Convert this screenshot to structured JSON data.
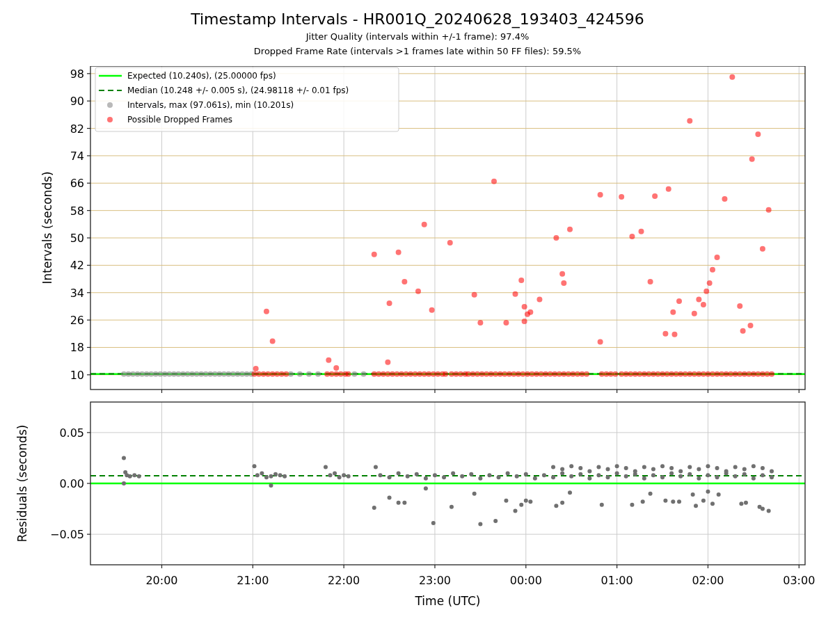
{
  "title": "Timestamp Intervals - HR001Q_20240628_193403_424596",
  "subtitles": [
    "Jitter Quality (intervals within +/-1 frame): 97.4%",
    "Dropped Frame Rate (intervals >1 frames late within 50 FF files): 59.5%"
  ],
  "plots": [
    {
      "chart_data": {
        "type": "scatter",
        "ylabel": "Intervals (seconds)",
        "xlim": [
          "2024-06-28T19:13",
          "2024-06-29T03:04"
        ],
        "ylim": [
          5.7,
          100.2
        ],
        "yticks": [
          10,
          18,
          26,
          34,
          42,
          50,
          58,
          66,
          74,
          82,
          90,
          98
        ],
        "grid": true,
        "legend": "upper left",
        "ref_lines": [
          {
            "axis": "y",
            "value": 10.24,
            "label": "Expected (10.240s), (25.00000 fps)",
            "color": "#00ff00"
          },
          {
            "axis": "y",
            "value": 10.248,
            "label": "Median (10.248 +/- 0.005 s), (24.98118 +/- 0.01 fps)",
            "color": "#008000"
          }
        ],
        "series": [
          {
            "name": "Intervals, max (97.061s), min (10.201s)",
            "color": "#808080",
            "x": [
              "2024-06-28T19:35",
              "2024-06-28T19:38",
              "2024-06-28T19:41",
              "2024-06-28T19:44",
              "2024-06-28T19:47",
              "2024-06-28T19:50",
              "2024-06-28T19:53",
              "2024-06-28T19:56",
              "2024-06-28T19:59",
              "2024-06-28T20:02",
              "2024-06-28T20:05",
              "2024-06-28T20:08",
              "2024-06-28T20:11",
              "2024-06-28T20:14",
              "2024-06-28T20:17",
              "2024-06-28T20:20",
              "2024-06-28T20:23",
              "2024-06-28T20:26",
              "2024-06-28T20:29",
              "2024-06-28T20:32",
              "2024-06-28T20:35",
              "2024-06-28T20:38",
              "2024-06-28T20:41",
              "2024-06-28T20:44",
              "2024-06-28T20:47",
              "2024-06-28T20:50",
              "2024-06-28T20:53",
              "2024-06-28T20:56",
              "2024-06-28T20:59",
              "2024-06-28T21:25",
              "2024-06-28T21:31",
              "2024-06-28T21:37",
              "2024-06-28T21:43",
              "2024-06-28T22:07",
              "2024-06-28T22:13"
            ],
            "values": [
              10.24,
              10.24,
              10.24,
              10.24,
              10.24,
              10.24,
              10.24,
              10.24,
              10.24,
              10.24,
              10.24,
              10.24,
              10.24,
              10.24,
              10.24,
              10.24,
              10.24,
              10.24,
              10.24,
              10.24,
              10.24,
              10.24,
              10.24,
              10.24,
              10.24,
              10.24,
              10.24,
              10.24,
              10.24,
              10.24,
              10.24,
              10.24,
              10.24,
              10.24,
              10.24
            ]
          },
          {
            "name": "Possible Dropped Frames",
            "color": "#ff0000",
            "x": [
              "2024-06-28T21:01",
              "2024-06-28T21:04",
              "2024-06-28T21:07",
              "2024-06-28T21:10",
              "2024-06-28T21:13",
              "2024-06-28T21:16",
              "2024-06-28T21:19",
              "2024-06-28T21:22",
              "2024-06-28T21:49",
              "2024-06-28T21:52",
              "2024-06-28T21:55",
              "2024-06-28T21:58",
              "2024-06-28T22:01",
              "2024-06-28T22:03",
              "2024-06-28T22:20",
              "2024-06-28T22:23",
              "2024-06-28T22:26",
              "2024-06-28T22:29",
              "2024-06-28T22:32",
              "2024-06-28T22:35",
              "2024-06-28T22:38",
              "2024-06-28T22:41",
              "2024-06-28T22:44",
              "2024-06-28T22:47",
              "2024-06-28T22:50",
              "2024-06-28T22:53",
              "2024-06-28T22:56",
              "2024-06-28T22:59",
              "2024-06-28T23:02",
              "2024-06-28T23:05",
              "2024-06-28T23:07",
              "2024-06-28T23:11",
              "2024-06-28T23:14",
              "2024-06-28T23:17",
              "2024-06-28T23:20",
              "2024-06-28T23:22",
              "2024-06-28T23:25",
              "2024-06-28T23:28",
              "2024-06-28T23:31",
              "2024-06-28T23:34",
              "2024-06-28T23:37",
              "2024-06-28T23:40",
              "2024-06-28T23:43",
              "2024-06-28T23:46",
              "2024-06-28T23:49",
              "2024-06-28T23:52",
              "2024-06-28T23:55",
              "2024-06-28T23:58",
              "2024-06-29T00:01",
              "2024-06-29T00:04",
              "2024-06-29T00:07",
              "2024-06-29T00:10",
              "2024-06-29T00:13",
              "2024-06-29T00:16",
              "2024-06-29T00:19",
              "2024-06-29T00:22",
              "2024-06-29T00:25",
              "2024-06-29T00:28",
              "2024-06-29T00:31",
              "2024-06-29T00:34",
              "2024-06-29T00:37",
              "2024-06-29T00:40",
              "2024-06-29T00:50",
              "2024-06-29T00:53",
              "2024-06-29T00:56",
              "2024-06-29T00:59",
              "2024-06-29T01:03",
              "2024-06-29T01:06",
              "2024-06-29T01:09",
              "2024-06-29T01:12",
              "2024-06-29T01:15",
              "2024-06-29T01:18",
              "2024-06-29T01:21",
              "2024-06-29T01:24",
              "2024-06-29T01:27",
              "2024-06-29T01:30",
              "2024-06-29T01:33",
              "2024-06-29T01:36",
              "2024-06-29T01:39",
              "2024-06-29T01:42",
              "2024-06-29T01:45",
              "2024-06-29T01:48",
              "2024-06-29T01:51",
              "2024-06-29T01:54",
              "2024-06-29T01:57",
              "2024-06-29T02:00",
              "2024-06-29T02:03",
              "2024-06-29T02:06",
              "2024-06-29T02:09",
              "2024-06-29T02:12",
              "2024-06-29T02:15",
              "2024-06-29T02:18",
              "2024-06-29T02:21",
              "2024-06-29T02:24",
              "2024-06-29T02:27",
              "2024-06-29T02:30",
              "2024-06-29T02:33",
              "2024-06-29T02:36",
              "2024-06-29T02:39",
              "2024-06-29T02:42",
              "2024-06-28T21:02",
              "2024-06-28T21:09",
              "2024-06-28T21:13",
              "2024-06-28T21:50",
              "2024-06-28T21:55",
              "2024-06-28T22:20",
              "2024-06-28T22:29",
              "2024-06-28T22:30",
              "2024-06-28T22:36",
              "2024-06-28T22:40",
              "2024-06-28T22:49",
              "2024-06-28T22:53",
              "2024-06-28T22:58",
              "2024-06-28T23:10",
              "2024-06-28T23:26",
              "2024-06-28T23:30",
              "2024-06-28T23:39",
              "2024-06-28T23:47",
              "2024-06-28T23:53",
              "2024-06-28T23:57",
              "2024-06-28T23:59",
              "2024-06-28T23:59",
              "2024-06-29T00:01",
              "2024-06-29T00:03",
              "2024-06-29T00:09",
              "2024-06-29T00:20",
              "2024-06-29T00:24",
              "2024-06-29T00:25",
              "2024-06-29T00:29",
              "2024-06-29T00:49",
              "2024-06-29T00:49",
              "2024-06-29T01:03",
              "2024-06-29T01:10",
              "2024-06-29T01:16",
              "2024-06-29T01:22",
              "2024-06-29T01:25",
              "2024-06-29T01:32",
              "2024-06-29T01:34",
              "2024-06-29T01:37",
              "2024-06-29T01:38",
              "2024-06-29T01:41",
              "2024-06-29T01:48",
              "2024-06-29T01:51",
              "2024-06-29T01:54",
              "2024-06-29T01:57",
              "2024-06-29T01:59",
              "2024-06-29T02:01",
              "2024-06-29T02:03",
              "2024-06-29T02:06",
              "2024-06-29T02:11",
              "2024-06-29T02:16",
              "2024-06-29T02:21",
              "2024-06-29T02:23",
              "2024-06-29T02:28",
              "2024-06-29T02:29",
              "2024-06-29T02:33",
              "2024-06-29T02:36",
              "2024-06-29T02:40"
            ],
            "values": [
              10.24,
              10.24,
              10.24,
              10.24,
              10.24,
              10.24,
              10.24,
              10.24,
              10.24,
              10.24,
              10.24,
              10.24,
              10.24,
              10.24,
              10.24,
              10.24,
              10.24,
              10.24,
              10.24,
              10.24,
              10.24,
              10.24,
              10.24,
              10.24,
              10.24,
              10.24,
              10.24,
              10.24,
              10.24,
              10.24,
              10.24,
              10.24,
              10.24,
              10.24,
              10.24,
              10.24,
              10.24,
              10.24,
              10.24,
              10.24,
              10.24,
              10.24,
              10.24,
              10.24,
              10.24,
              10.24,
              10.24,
              10.24,
              10.24,
              10.24,
              10.24,
              10.24,
              10.24,
              10.24,
              10.24,
              10.24,
              10.24,
              10.24,
              10.24,
              10.24,
              10.24,
              10.24,
              10.24,
              10.24,
              10.24,
              10.24,
              10.24,
              10.24,
              10.24,
              10.24,
              10.24,
              10.24,
              10.24,
              10.24,
              10.24,
              10.24,
              10.24,
              10.24,
              10.24,
              10.24,
              10.24,
              10.24,
              10.24,
              10.24,
              10.24,
              10.24,
              10.24,
              10.24,
              10.24,
              10.24,
              10.24,
              10.24,
              10.24,
              10.24,
              10.24,
              10.24,
              10.24,
              10.24,
              10.24,
              10.24,
              11.8,
              28.5,
              19.8,
              14.3,
              12.0,
              45.2,
              13.7,
              30.9,
              45.8,
              37.2,
              34.4,
              53.9,
              28.9,
              48.6,
              33.4,
              25.2,
              66.5,
              25.2,
              33.6,
              37.6,
              29.9,
              25.6,
              27.7,
              28.3,
              32.0,
              50.0,
              39.5,
              36.8,
              52.5,
              19.6,
              62.6,
              62.0,
              50.4,
              51.9,
              37.2,
              62.2,
              22.0,
              64.3,
              28.3,
              21.8,
              31.5,
              84.2,
              27.9,
              32.0,
              30.5,
              34.4,
              36.8,
              40.7,
              44.3,
              61.4,
              97.0,
              30.1,
              22.8,
              24.4,
              73.0,
              80.3,
              46.8,
              58.2
            ]
          }
        ]
      }
    },
    {
      "chart_data": {
        "type": "scatter",
        "xlabel": "Time (UTC)",
        "ylabel": "Residuals (seconds)",
        "xlim": [
          "2024-06-28T19:13",
          "2024-06-29T03:04"
        ],
        "ylim": [
          -0.08,
          0.08
        ],
        "xticks": [
          {
            "value": "2024-06-28T20:00",
            "label": "20:00"
          },
          {
            "value": "2024-06-28T21:00",
            "label": "21:00"
          },
          {
            "value": "2024-06-28T22:00",
            "label": "22:00"
          },
          {
            "value": "2024-06-28T23:00",
            "label": "23:00"
          },
          {
            "value": "2024-06-29T00:00",
            "label": "00:00"
          },
          {
            "value": "2024-06-29T01:00",
            "label": "01:00"
          },
          {
            "value": "2024-06-29T02:00",
            "label": "02:00"
          },
          {
            "value": "2024-06-29T03:00",
            "label": "03:00"
          }
        ],
        "yticks": [
          {
            "value": -0.05,
            "label": "−0.05"
          },
          {
            "value": 0,
            "label": "0.00"
          },
          {
            "value": 0.05,
            "label": "0.05"
          }
        ],
        "grid": true,
        "ref_lines": [
          {
            "axis": "y",
            "value": 0,
            "color": "#00ff00"
          },
          {
            "axis": "y",
            "value": 0.0075,
            "color": "#008000"
          }
        ],
        "series": [
          {
            "color": "#707070",
            "x": [
              "2024-06-28T19:35",
              "2024-06-28T19:35",
              "2024-06-28T19:36",
              "2024-06-28T19:37",
              "2024-06-28T19:39",
              "2024-06-28T19:42",
              "2024-06-28T19:45",
              "2024-06-28T21:01",
              "2024-06-28T21:03",
              "2024-06-28T21:06",
              "2024-06-28T21:09",
              "2024-06-28T21:12",
              "2024-06-28T21:12",
              "2024-06-28T21:15",
              "2024-06-28T21:18",
              "2024-06-28T21:21",
              "2024-06-28T21:48",
              "2024-06-28T21:51",
              "2024-06-28T21:54",
              "2024-06-28T21:57",
              "2024-06-28T22:00",
              "2024-06-28T22:03",
              "2024-06-28T22:21",
              "2024-06-28T22:24",
              "2024-06-28T22:30",
              "2024-06-28T22:36",
              "2024-06-28T22:42",
              "2024-06-28T22:48",
              "2024-06-28T22:54",
              "2024-06-28T23:00",
              "2024-06-28T23:06",
              "2024-06-28T23:12",
              "2024-06-28T23:18",
              "2024-06-28T23:24",
              "2024-06-28T23:30",
              "2024-06-28T23:36",
              "2024-06-28T23:42",
              "2024-06-28T23:48",
              "2024-06-28T23:54",
              "2024-06-29T00:00",
              "2024-06-29T00:06",
              "2024-06-29T00:12",
              "2024-06-29T00:18",
              "2024-06-29T00:24",
              "2024-06-29T00:30",
              "2024-06-29T00:36",
              "2024-06-29T00:42",
              "2024-06-29T00:48",
              "2024-06-29T00:54",
              "2024-06-29T01:00",
              "2024-06-29T01:06",
              "2024-06-29T01:12",
              "2024-06-29T01:18",
              "2024-06-29T01:24",
              "2024-06-29T01:30",
              "2024-06-29T01:36",
              "2024-06-29T01:42",
              "2024-06-29T01:48",
              "2024-06-29T01:54",
              "2024-06-29T02:00",
              "2024-06-29T02:06",
              "2024-06-29T02:12",
              "2024-06-29T02:18",
              "2024-06-29T02:24",
              "2024-06-29T02:30",
              "2024-06-29T02:36",
              "2024-06-29T02:42",
              "2024-06-29T00:18",
              "2024-06-29T00:24",
              "2024-06-29T00:30",
              "2024-06-29T00:36",
              "2024-06-29T00:42",
              "2024-06-29T00:48",
              "2024-06-29T00:54",
              "2024-06-29T01:00",
              "2024-06-29T01:06",
              "2024-06-29T01:12",
              "2024-06-29T01:18",
              "2024-06-29T01:24",
              "2024-06-29T01:30",
              "2024-06-29T01:36",
              "2024-06-29T01:42",
              "2024-06-29T01:48",
              "2024-06-29T01:54",
              "2024-06-29T02:00",
              "2024-06-29T02:06",
              "2024-06-29T02:12",
              "2024-06-29T02:18",
              "2024-06-29T02:24",
              "2024-06-29T02:30",
              "2024-06-29T02:36",
              "2024-06-29T02:42",
              "2024-06-28T22:20",
              "2024-06-28T22:30",
              "2024-06-28T22:36",
              "2024-06-28T22:40",
              "2024-06-28T22:54",
              "2024-06-28T22:59",
              "2024-06-28T23:11",
              "2024-06-28T23:26",
              "2024-06-28T23:30",
              "2024-06-28T23:40",
              "2024-06-28T23:47",
              "2024-06-28T23:53",
              "2024-06-28T23:57",
              "2024-06-29T00:00",
              "2024-06-29T00:03",
              "2024-06-29T00:20",
              "2024-06-29T00:24",
              "2024-06-29T00:29",
              "2024-06-29T00:50",
              "2024-06-29T01:10",
              "2024-06-29T01:17",
              "2024-06-29T01:22",
              "2024-06-29T01:32",
              "2024-06-29T01:37",
              "2024-06-29T01:41",
              "2024-06-29T01:50",
              "2024-06-29T01:52",
              "2024-06-29T01:57",
              "2024-06-29T02:00",
              "2024-06-29T02:03",
              "2024-06-29T02:07",
              "2024-06-29T02:22",
              "2024-06-29T02:25",
              "2024-06-29T02:34",
              "2024-06-29T02:36",
              "2024-06-29T02:40"
            ],
            "values": [
              0.025,
              0.0,
              0.011,
              0.008,
              0.007,
              0.008,
              0.007,
              0.017,
              0.008,
              0.01,
              0.006,
              0.007,
              -0.002,
              0.009,
              0.008,
              0.007,
              0.016,
              0.008,
              0.01,
              0.006,
              0.008,
              0.007,
              0.016,
              0.008,
              0.006,
              0.01,
              0.007,
              0.009,
              0.005,
              0.008,
              0.006,
              0.01,
              0.007,
              0.009,
              0.005,
              0.008,
              0.006,
              0.01,
              0.007,
              0.009,
              0.005,
              0.008,
              0.006,
              0.01,
              0.007,
              0.009,
              0.005,
              0.008,
              0.006,
              0.01,
              0.007,
              0.009,
              0.005,
              0.008,
              0.006,
              0.01,
              0.007,
              0.009,
              0.005,
              0.008,
              0.006,
              0.01,
              0.007,
              0.009,
              0.005,
              0.008,
              0.006,
              0.016,
              0.014,
              0.017,
              0.015,
              0.012,
              0.016,
              0.014,
              0.017,
              0.015,
              0.012,
              0.016,
              0.014,
              0.017,
              0.015,
              0.012,
              0.016,
              0.014,
              0.017,
              0.015,
              0.012,
              0.016,
              0.014,
              0.017,
              0.015,
              0.012,
              -0.024,
              -0.014,
              -0.019,
              -0.019,
              -0.005,
              -0.039,
              -0.023,
              -0.01,
              -0.04,
              -0.037,
              -0.017,
              -0.027,
              -0.021,
              -0.017,
              -0.018,
              -0.022,
              -0.019,
              -0.009,
              -0.021,
              -0.021,
              -0.018,
              -0.01,
              -0.017,
              -0.018,
              -0.018,
              -0.011,
              -0.022,
              -0.017,
              -0.008,
              -0.02,
              -0.011,
              -0.02,
              -0.019,
              -0.023,
              -0.025,
              -0.027
            ]
          }
        ]
      }
    }
  ]
}
